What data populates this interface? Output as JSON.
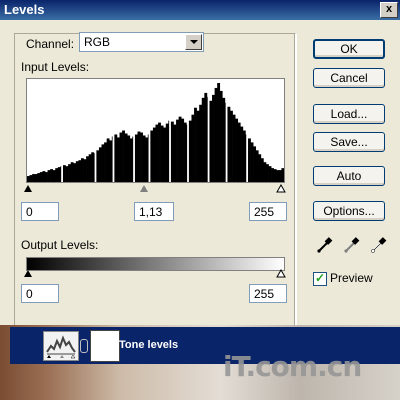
{
  "window": {
    "title": "Levels",
    "close_label": "x"
  },
  "channel": {
    "label": "Channel:",
    "value": "RGB"
  },
  "input_levels": {
    "label": "Input Levels:",
    "black": "0",
    "gamma": "1,13",
    "white": "255"
  },
  "output_levels": {
    "label": "Output Levels:",
    "black": "0",
    "white": "255"
  },
  "buttons": {
    "ok": "OK",
    "cancel": "Cancel",
    "load": "Load...",
    "save": "Save...",
    "auto": "Auto",
    "options": "Options..."
  },
  "preview": {
    "label": "Preview",
    "checked": true
  },
  "eyedroppers": [
    "black-point-eyedropper-icon",
    "gray-point-eyedropper-icon",
    "white-point-eyedropper-icon"
  ],
  "layer": {
    "name": "Tone levels"
  },
  "watermark": {
    "text": "iT.com.cn"
  },
  "histogram": {
    "values": [
      6,
      7,
      8,
      8,
      9,
      10,
      11,
      10,
      12,
      13,
      12,
      14,
      15,
      16,
      17,
      16,
      18,
      20,
      19,
      21,
      22,
      24,
      23,
      26,
      28,
      30,
      29,
      32,
      35,
      38,
      40,
      44,
      42,
      46,
      48,
      45,
      50,
      52,
      49,
      47,
      44,
      46,
      48,
      51,
      50,
      47,
      45,
      48,
      52,
      55,
      58,
      60,
      57,
      55,
      59,
      62,
      61,
      58,
      63,
      66,
      64,
      60,
      58,
      62,
      68,
      75,
      72,
      78,
      85,
      90,
      86,
      82,
      88,
      95,
      100,
      92,
      85,
      80,
      76,
      72,
      68,
      64,
      60,
      56,
      52,
      48,
      44,
      40,
      36,
      32,
      28,
      24,
      20,
      18,
      16,
      14,
      13,
      12,
      12,
      14
    ],
    "gaps": [
      13,
      26,
      33,
      41,
      47,
      55,
      62,
      70,
      77,
      85
    ]
  },
  "colors": {
    "title_bar": "#0a246a",
    "dialog_bg": "#ece9d8",
    "layer_highlight": "#0a246a"
  }
}
